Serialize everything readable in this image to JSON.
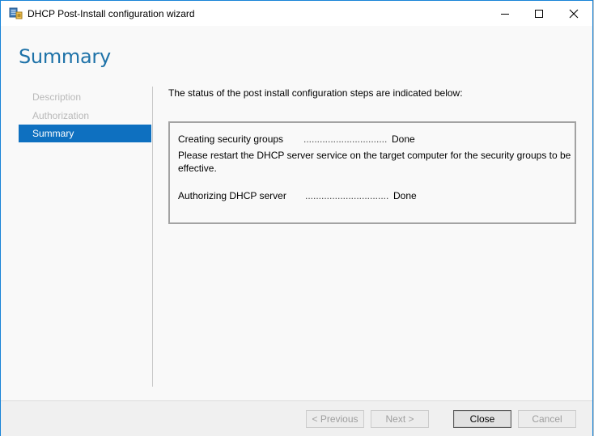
{
  "window": {
    "title": "DHCP Post-Install configuration wizard"
  },
  "heading": "Summary",
  "nav": {
    "items": [
      {
        "label": "Description",
        "active": false
      },
      {
        "label": "Authorization",
        "active": false
      },
      {
        "label": "Summary",
        "active": true
      }
    ]
  },
  "content": {
    "intro": "The status of the post install configuration steps are indicated below:",
    "steps": [
      {
        "label": "Creating security groups",
        "status": "Done",
        "dots": "......................................................"
      },
      {
        "label": "Authorizing DHCP server",
        "status": "Done",
        "dots": "......................................................"
      }
    ],
    "note_line1": "Please restart the DHCP server service on the target computer for the security groups to be",
    "note_line2": "effective."
  },
  "footer": {
    "previous_label": "< Previous",
    "next_label": "Next >",
    "close_label": "Close",
    "cancel_label": "Cancel"
  },
  "colors": {
    "accent": "#0e70c0",
    "heading": "#1e72a8",
    "border": "#1883d7"
  },
  "icons": {
    "app": "dhcp-server-icon",
    "minimize": "minimize-icon",
    "maximize": "maximize-icon",
    "close": "close-icon"
  }
}
